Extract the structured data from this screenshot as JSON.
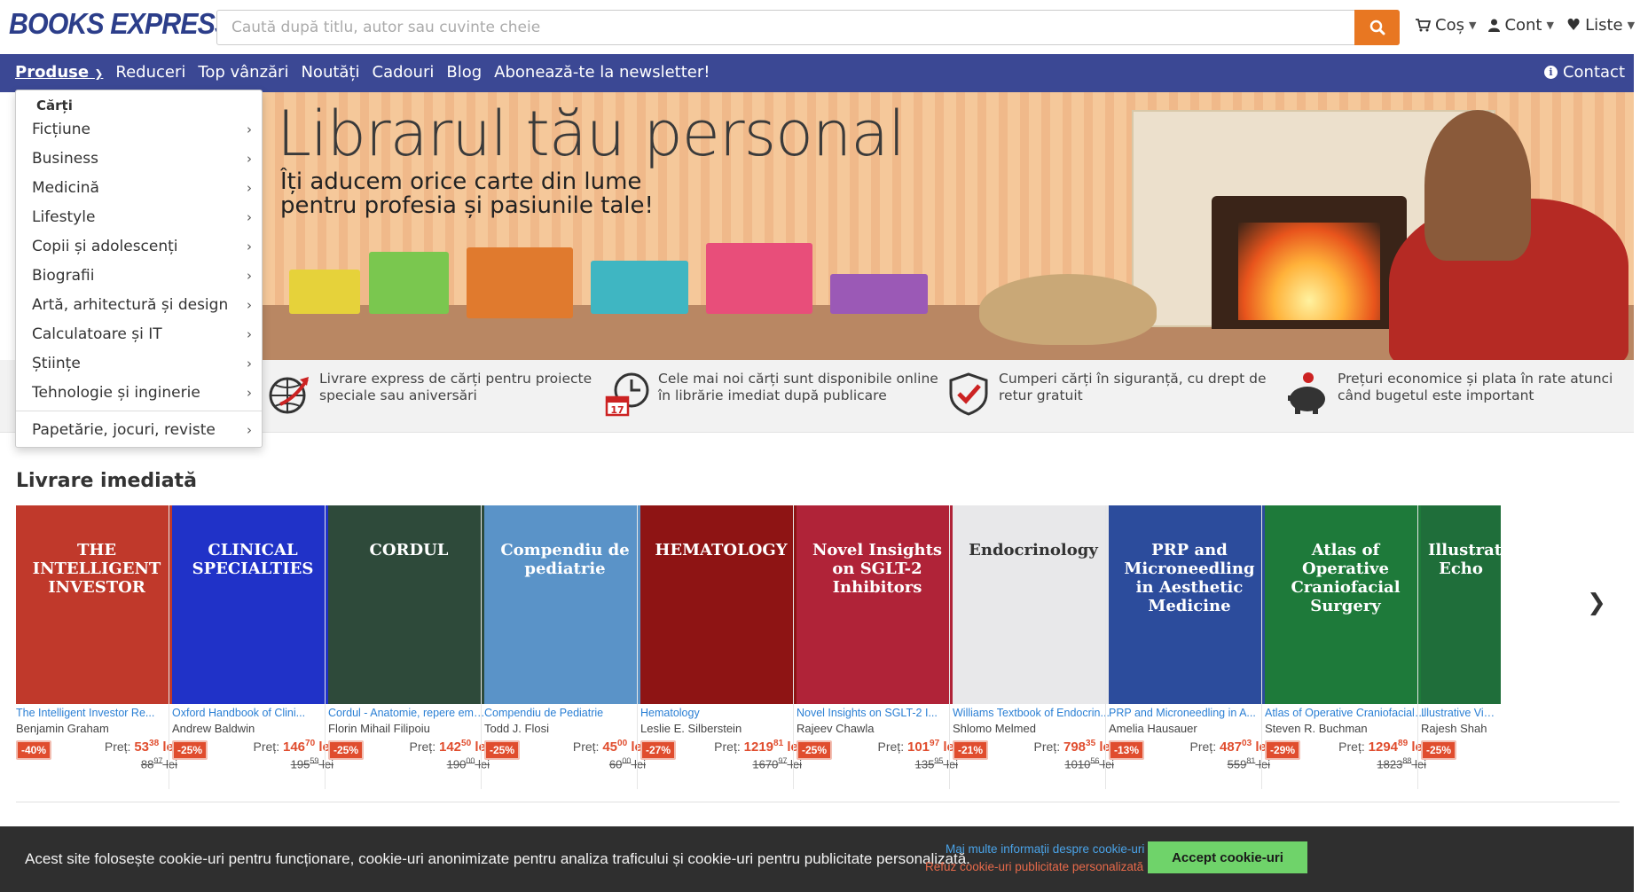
{
  "header": {
    "logo": "BOOKS EXPRESS",
    "search_placeholder": "Caută după titlu, autor sau cuvinte cheie",
    "cart": "Coș",
    "account": "Cont",
    "lists": "Liste"
  },
  "nav": {
    "items": [
      "Produse",
      "Reduceri",
      "Top vânzări",
      "Noutăți",
      "Cadouri",
      "Blog",
      "Abonează-te la newsletter!"
    ],
    "contact": "Contact"
  },
  "dropdown": {
    "heading": "Cărți",
    "items": [
      "Ficțiune",
      "Business",
      "Medicină",
      "Lifestyle",
      "Copii și adolescenți",
      "Biografii",
      "Artă, arhitectură și design",
      "Calculatoare și IT",
      "Științe",
      "Tehnologie și inginerie"
    ],
    "extra": "Papetărie, jocuri, reviste"
  },
  "banner": {
    "title": "Librarul tău personal",
    "subtitle_line1": "Îți aducem orice carte din lume",
    "subtitle_line2": "pentru profesia și pasiunile tale!"
  },
  "features": [
    {
      "line1": "Livrare express de cărți pentru proiecte",
      "line2": "speciale sau aniversări"
    },
    {
      "line1": "Cele mai noi cărți sunt disponibile online",
      "line2": "în librărie imediat după publicare"
    },
    {
      "line1": "Cumperi cărți în siguranță, cu drept de",
      "line2": "retur gratuit"
    },
    {
      "line1": "Prețuri economice și plata în rate atunci",
      "line2": "când bugetul este important"
    }
  ],
  "section": {
    "title": "Livrare imediată",
    "price_label": "Preț:",
    "currency": "lei"
  },
  "books": [
    {
      "title": "The Intelligent Investor Re...",
      "author": "Benjamin Graham",
      "discount": "-40%",
      "price_int": "53",
      "price_dec": "38",
      "old_int": "88",
      "old_dec": "97",
      "cover_color": "#c0392b",
      "cover_text": "THE INTELLIGENT INVESTOR"
    },
    {
      "title": "Oxford Handbook of Clini...",
      "author": "Andrew Baldwin",
      "discount": "-25%",
      "price_int": "146",
      "price_dec": "70",
      "old_int": "195",
      "old_dec": "59",
      "cover_color": "#2032c8",
      "cover_text": "CLINICAL SPECIALTIES"
    },
    {
      "title": "Cordul - Anatomie, repere embri...",
      "author": "Florin Mihail Filipoiu",
      "discount": "-25%",
      "price_int": "142",
      "price_dec": "50",
      "old_int": "190",
      "old_dec": "00",
      "cover_color": "#2e4a3a",
      "cover_text": "CORDUL"
    },
    {
      "title": "Compendiu de Pediatrie",
      "author": "Todd J. Flosi",
      "discount": "-25%",
      "price_int": "45",
      "price_dec": "00",
      "old_int": "60",
      "old_dec": "00",
      "cover_color": "#5a93c8",
      "cover_text": "Compendiu de pediatrie"
    },
    {
      "title": "Hematology",
      "author": "Leslie E. Silberstein",
      "discount": "-27%",
      "price_int": "1219",
      "price_dec": "81",
      "old_int": "1670",
      "old_dec": "97",
      "cover_color": "#8e1414",
      "cover_text": "HEMATOLOGY"
    },
    {
      "title": "Novel Insights on SGLT-2 I...",
      "author": "Rajeev Chawla",
      "discount": "-25%",
      "price_int": "101",
      "price_dec": "97",
      "old_int": "135",
      "old_dec": "95",
      "cover_color": "#b02338",
      "cover_text": "Novel Insights on SGLT-2 Inhibitors"
    },
    {
      "title": "Williams Textbook of Endocrin...",
      "author": "Shlomo Melmed",
      "discount": "-21%",
      "price_int": "798",
      "price_dec": "35",
      "old_int": "1010",
      "old_dec": "56",
      "cover_color": "#e8e8ea",
      "cover_text": "Endocrinology"
    },
    {
      "title": "PRP and Microneedling in A...",
      "author": "Amelia Hausauer",
      "discount": "-13%",
      "price_int": "487",
      "price_dec": "03",
      "old_int": "559",
      "old_dec": "81",
      "cover_color": "#2c4c9c",
      "cover_text": "PRP and Microneedling in Aesthetic Medicine"
    },
    {
      "title": "Atlas of Operative Craniofacial ...",
      "author": "Steven R. Buchman",
      "discount": "-29%",
      "price_int": "1294",
      "price_dec": "89",
      "old_int": "1823",
      "old_dec": "88",
      "cover_color": "#1e7a3a",
      "cover_text": "Atlas of Operative Craniofacial Surgery"
    },
    {
      "title": "Illustrative Video...",
      "author": "Rajesh Shah",
      "discount": "-25%",
      "price_int": "",
      "price_dec": "",
      "old_int": "",
      "old_dec": "",
      "cover_color": "#1f6e3a",
      "cover_text": "Illustrative Echo"
    }
  ],
  "cookie": {
    "text": "Acest site folosește cookie-uri pentru funcționare, cookie-uri anonimizate pentru analiza traficului și cookie-uri pentru publicitate personalizată.",
    "more": "Mai multe informații despre cookie-uri",
    "refuse": "Refuz cookie-uri publicitate personalizată",
    "accept": "Accept cookie-uri"
  },
  "colors": {
    "nav_bg": "#3b4894",
    "accent_orange": "#e87722",
    "discount_red": "#e04d2e",
    "link_blue": "#2a7fd4",
    "cookie_bg": "#2f2f2f",
    "accept_green": "#6fd36a"
  }
}
